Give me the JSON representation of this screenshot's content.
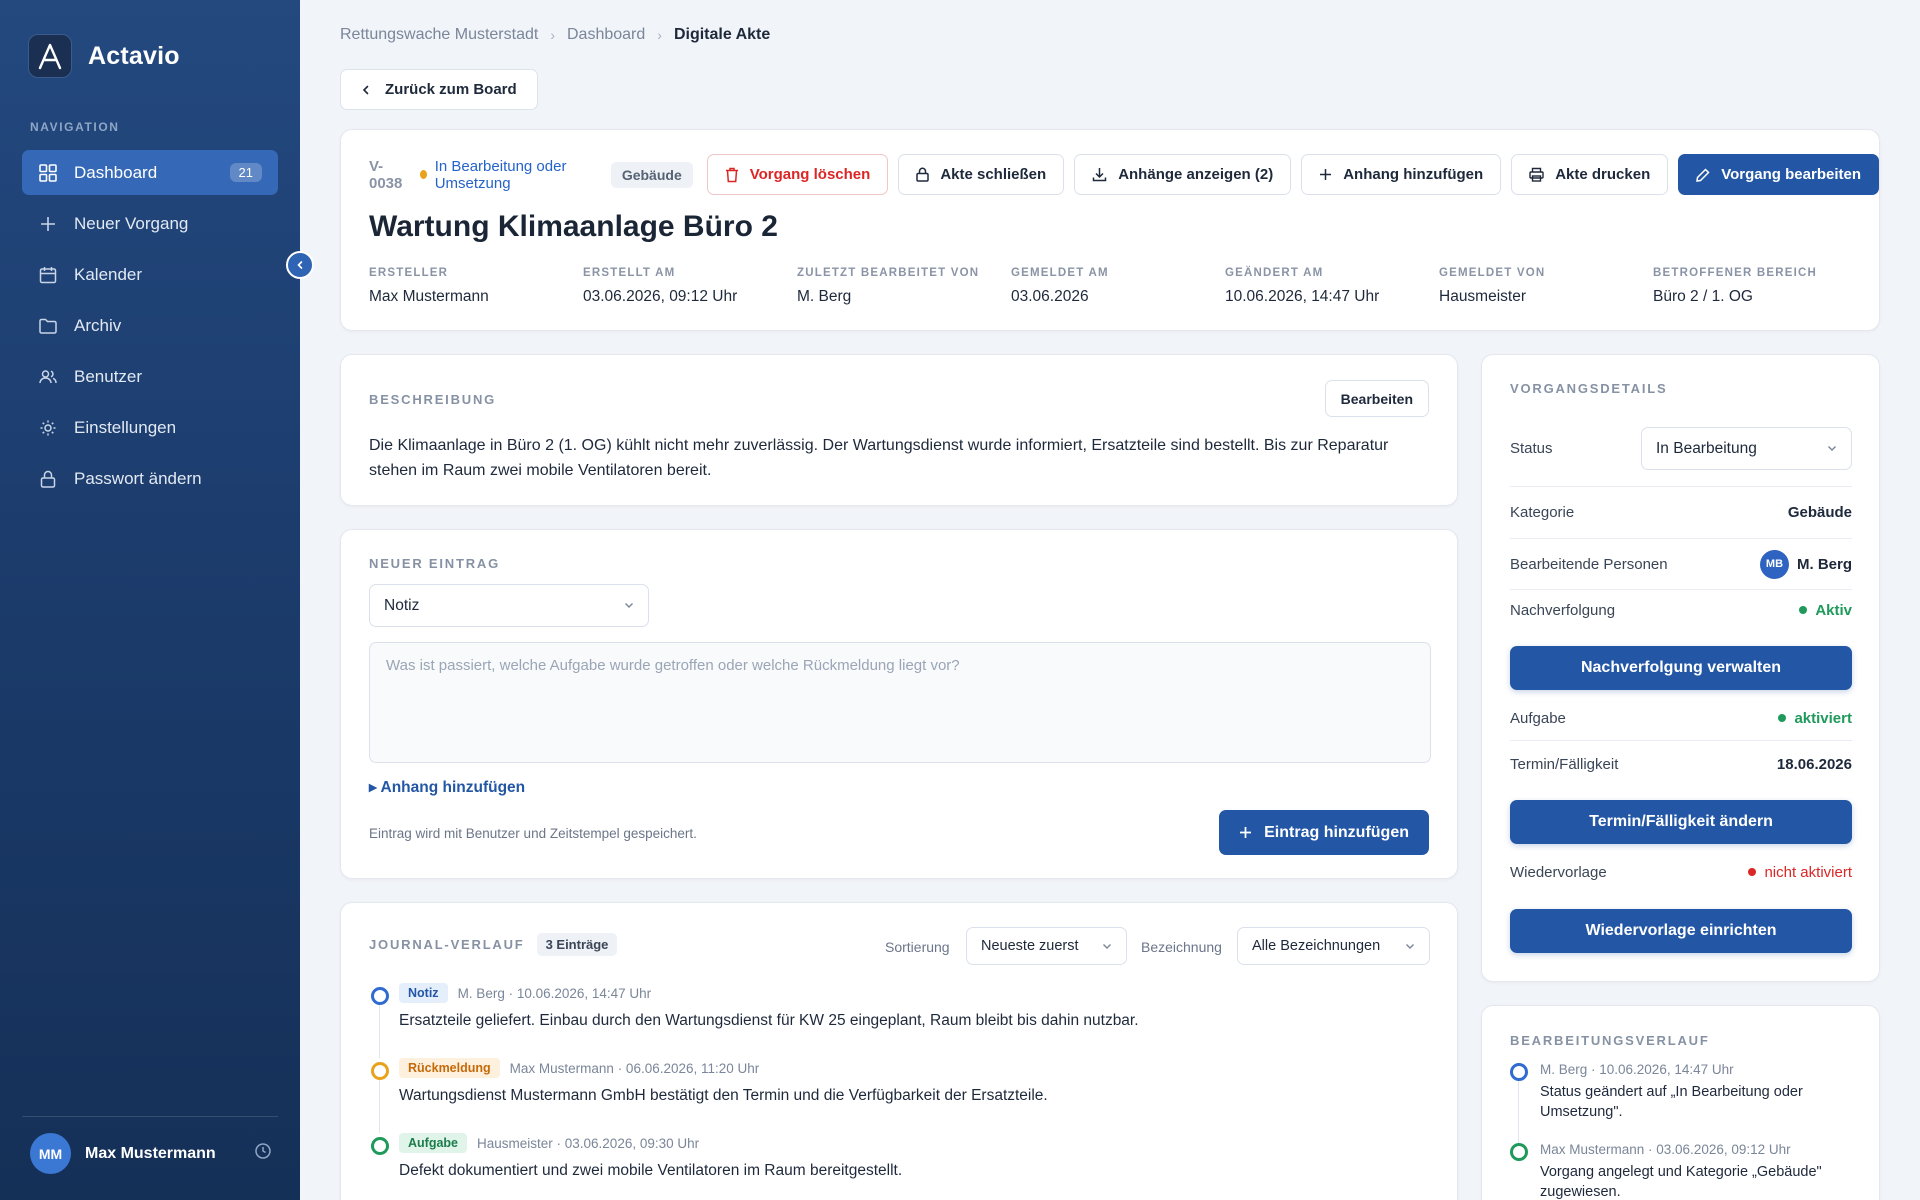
{
  "app": {
    "name": "Actavio",
    "logo_letter": "A"
  },
  "sidebar": {
    "heading": "NAVIGATION",
    "items": [
      {
        "label": "Dashboard",
        "icon": "grid-icon",
        "badge": "21",
        "active": true
      },
      {
        "label": "Neuer Vorgang",
        "icon": "plus-icon"
      },
      {
        "label": "Kalender",
        "icon": "calendar-icon"
      },
      {
        "label": "Archiv",
        "icon": "folder-icon"
      },
      {
        "label": "Benutzer",
        "icon": "users-icon"
      },
      {
        "label": "Einstellungen",
        "icon": "sun-gear-icon"
      },
      {
        "label": "Passwort ändern",
        "icon": "lock-icon"
      }
    ],
    "user": {
      "initials": "MM",
      "name": "Max Mustermann"
    }
  },
  "breadcrumb": {
    "items": [
      "Rettungswache Musterstadt",
      "Dashboard"
    ],
    "current": "Digitale Akte"
  },
  "back_button": "Zurück zum Board",
  "record": {
    "id": "V-0038",
    "status": "In Bearbeitung oder Umsetzung",
    "category_tag": "Gebäude",
    "title": "Wartung Klimaanlage Büro 2",
    "actions": {
      "delete": "Vorgang löschen",
      "close": "Akte schließen",
      "show_attachments": "Anhänge anzeigen (2)",
      "add_attachment": "Anhang hinzufügen",
      "print": "Akte drucken",
      "edit": "Vorgang bearbeiten"
    },
    "meta": [
      {
        "label": "ERSTELLER",
        "value": "Max Mustermann"
      },
      {
        "label": "ERSTELLT AM",
        "value": "03.06.2026, 09:12 Uhr"
      },
      {
        "label": "ZULETZT BEARBEITET VON",
        "value": "M. Berg"
      },
      {
        "label": "GEMELDET AM",
        "value": "03.06.2026"
      },
      {
        "label": "GEÄNDERT AM",
        "value": "10.06.2026, 14:47 Uhr"
      },
      {
        "label": "GEMELDET VON",
        "value": "Hausmeister"
      },
      {
        "label": "BETROFFENER BEREICH",
        "value": "Büro 2 / 1. OG"
      }
    ]
  },
  "description": {
    "label": "BESCHREIBUNG",
    "edit_button": "Bearbeiten",
    "text": "Die Klimaanlage in Büro 2 (1. OG) kühlt nicht mehr zuverlässig. Der Wartungsdienst wurde informiert, Ersatzteile sind bestellt. Bis zur Reparatur stehen im Raum zwei mobile Ventilatoren bereit."
  },
  "new_entry": {
    "label": "NEUER EINTRAG",
    "type_value": "Notiz",
    "placeholder": "Was ist passiert, welche Aufgabe wurde getroffen oder welche Rückmeldung liegt vor?",
    "attach_link": "▸ Anhang hinzufügen",
    "hint": "Eintrag wird mit Benutzer und Zeitstempel gespeichert.",
    "submit": "Eintrag hinzufügen"
  },
  "journal": {
    "label": "JOURNAL-VERLAUF",
    "count": "3 Einträge",
    "sort_label": "Sortierung",
    "sort_value": "Neueste zuerst",
    "filter_label": "Bezeichnung",
    "filter_value": "Alle Bezeichnungen",
    "entries": [
      {
        "type": "Notiz",
        "meta": "M. Berg · 10.06.2026, 14:47 Uhr",
        "text": "Ersatzteile geliefert. Einbau durch den Wartungsdienst für KW 25 eingeplant, Raum bleibt bis dahin nutzbar.",
        "color": "#2f6bd0",
        "badge_bg": "#e5eefb",
        "badge_fg": "#2357a5"
      },
      {
        "type": "Rückmeldung",
        "meta": "Max Mustermann · 06.06.2026, 11:20 Uhr",
        "text": "Wartungsdienst Mustermann GmbH bestätigt den Termin und die Verfügbarkeit der Ersatzteile.",
        "color": "#e9a21c",
        "badge_bg": "#fdf0dc",
        "badge_fg": "#c46a0a"
      },
      {
        "type": "Aufgabe",
        "meta": "Hausmeister · 03.06.2026, 09:30 Uhr",
        "text": "Defekt dokumentiert und zwei mobile Ventilatoren im Raum bereitgestellt.",
        "color": "#1f9a5b",
        "badge_bg": "#e1f4ea",
        "badge_fg": "#1b7d4a"
      }
    ]
  },
  "details": {
    "label": "VORGANGSDETAILS",
    "status_label": "Status",
    "status_value": "In Bearbeitung",
    "category_label": "Kategorie",
    "category_value": "Gebäude",
    "persons_label": "Bearbeitende Personen",
    "person_initials": "MB",
    "person_name": "M. Berg",
    "followup_label": "Nachverfolgung",
    "followup_value": "Aktiv",
    "followup_button": "Nachverfolgung verwalten",
    "task_label": "Aufgabe",
    "task_value": "aktiviert",
    "due_label": "Termin/Fälligkeit",
    "due_value": "18.06.2026",
    "due_button": "Termin/Fälligkeit ändern",
    "resubmit_label": "Wiedervorlage",
    "resubmit_value": "nicht aktiviert",
    "resubmit_button": "Wiedervorlage einrichten"
  },
  "history": {
    "label": "BEARBEITUNGSVERLAUF",
    "entries": [
      {
        "meta": "M. Berg · 10.06.2026, 14:47 Uhr",
        "text": "Status geändert auf „In Bearbeitung oder Umsetzung\".",
        "color": "#2f6bd0"
      },
      {
        "meta": "Max Mustermann · 03.06.2026, 09:12 Uhr",
        "text": "Vorgang angelegt und Kategorie „Gebäude\" zugewiesen.",
        "color": "#1f9a5b"
      }
    ]
  },
  "colors": {
    "accent": "#2357a5",
    "sidebar": "#1c3c6d",
    "success": "#1f9a5b",
    "danger": "#dc2626",
    "warning": "#e9a21c"
  }
}
